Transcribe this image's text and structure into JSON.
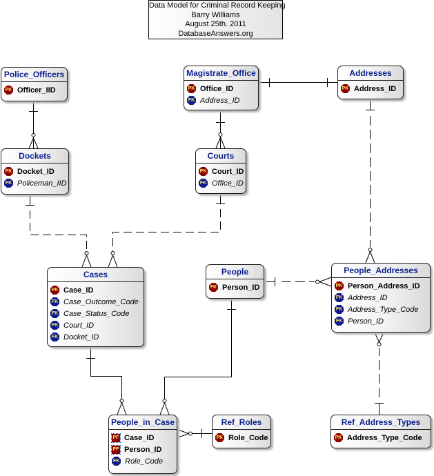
{
  "title": {
    "lines": [
      "Data Model for Criminal Record Keeping",
      "Barry Williams",
      "August 25th.  2011",
      "DatabaseAnswers.org"
    ]
  },
  "entities": {
    "police_officers": {
      "name": "Police_Officers",
      "attributes": [
        {
          "key": "PK",
          "name": "Officer_IID"
        }
      ]
    },
    "dockets": {
      "name": "Dockets",
      "attributes": [
        {
          "key": "PK",
          "name": "Docket_ID"
        },
        {
          "key": "FK",
          "name": "Policeman_IID"
        }
      ]
    },
    "magistrate_office": {
      "name": "Magistrate_Office",
      "attributes": [
        {
          "key": "PK",
          "name": "Office_ID"
        },
        {
          "key": "FK",
          "name": "Address_ID"
        }
      ]
    },
    "courts": {
      "name": "Courts",
      "attributes": [
        {
          "key": "PK",
          "name": "Court_ID"
        },
        {
          "key": "FK",
          "name": "Office_ID"
        }
      ]
    },
    "addresses": {
      "name": "Addresses",
      "attributes": [
        {
          "key": "PK",
          "name": "Address_ID"
        }
      ]
    },
    "cases": {
      "name": "Cases",
      "attributes": [
        {
          "key": "PK",
          "name": "Case_ID"
        },
        {
          "key": "FK",
          "name": "Case_Outcome_Code"
        },
        {
          "key": "FK",
          "name": "Case_Status_Code"
        },
        {
          "key": "FK",
          "name": "Court_ID"
        },
        {
          "key": "FK",
          "name": "Docket_ID"
        }
      ]
    },
    "people": {
      "name": "People",
      "attributes": [
        {
          "key": "FK",
          "name": "Person_ID"
        }
      ]
    },
    "people_addresses": {
      "name": "People_Addresses",
      "attributes": [
        {
          "key": "PK",
          "name": "Person_Address_ID"
        },
        {
          "key": "FK",
          "name": "Address_ID"
        },
        {
          "key": "FK",
          "name": "Address_Type_Code"
        },
        {
          "key": "FK",
          "name": "Person_ID"
        }
      ]
    },
    "people_in_case": {
      "name": "People_in_Case",
      "attributes": [
        {
          "key": "PF",
          "name": "Case_ID"
        },
        {
          "key": "PF",
          "name": "Person_ID"
        },
        {
          "key": "FK",
          "name": "Role_Code"
        }
      ]
    },
    "ref_roles": {
      "name": "Ref_Roles",
      "attributes": [
        {
          "key": "PK",
          "name": "Role_Code"
        }
      ]
    },
    "ref_address_types": {
      "name": "Ref_Address_Types",
      "attributes": [
        {
          "key": "PK",
          "name": "Address_Type_Code"
        }
      ]
    }
  },
  "relationships": [
    {
      "from": "Police_Officers",
      "to": "Dockets",
      "type": "one-to-zero-or-many",
      "identifying": true
    },
    {
      "from": "Magistrate_Office",
      "to": "Courts",
      "type": "one-to-zero-or-many",
      "identifying": true
    },
    {
      "from": "Addresses",
      "to": "Magistrate_Office",
      "type": "one-to-one",
      "identifying": false
    },
    {
      "from": "Dockets",
      "to": "Cases",
      "type": "one-to-zero-or-many",
      "identifying": false
    },
    {
      "from": "Courts",
      "to": "Cases",
      "type": "one-to-zero-or-many",
      "identifying": false
    },
    {
      "from": "Addresses",
      "to": "People_Addresses",
      "type": "one-to-zero-or-many",
      "identifying": false
    },
    {
      "from": "People",
      "to": "People_Addresses",
      "type": "one-to-zero-or-many",
      "identifying": false
    },
    {
      "from": "Ref_Address_Types",
      "to": "People_Addresses",
      "type": "one-to-zero-or-many",
      "identifying": false
    },
    {
      "from": "Cases",
      "to": "People_in_Case",
      "type": "one-to-zero-or-many",
      "identifying": true
    },
    {
      "from": "People",
      "to": "People_in_Case",
      "type": "one-to-zero-or-many",
      "identifying": true
    },
    {
      "from": "Ref_Roles",
      "to": "People_in_Case",
      "type": "one-to-zero-or-many",
      "identifying": true
    }
  ]
}
